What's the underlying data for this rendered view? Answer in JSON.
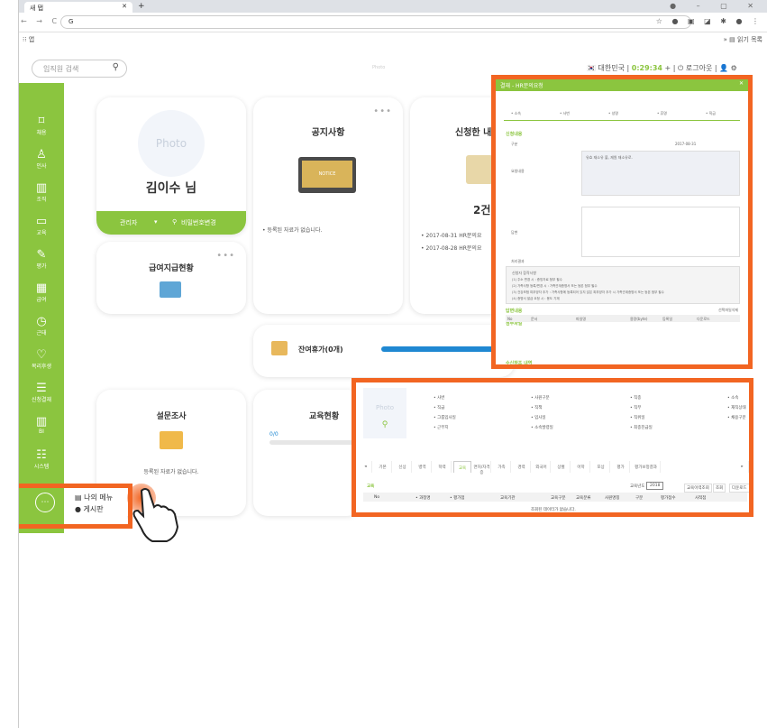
{
  "browser": {
    "tab_title": "새 탭",
    "address": "G",
    "bookmarks_left": "앱",
    "bookmarks_right": "읽기 목록"
  },
  "header": {
    "search_placeholder": "임직원 검색",
    "photo_label": "Photo",
    "country": "대한민국",
    "timer": "0:29:34",
    "plus": "+",
    "logout": "로그아웃"
  },
  "sidebar": {
    "items": [
      {
        "label": "채용",
        "icon": "bookmark-icon"
      },
      {
        "label": "인사",
        "icon": "person-icon"
      },
      {
        "label": "조직",
        "icon": "building-icon"
      },
      {
        "label": "교육",
        "icon": "laptop-icon"
      },
      {
        "label": "평가",
        "icon": "edit-icon"
      },
      {
        "label": "급여",
        "icon": "calculator-icon"
      },
      {
        "label": "근태",
        "icon": "clock-icon"
      },
      {
        "label": "복리후생",
        "icon": "heart-icon"
      },
      {
        "label": "신청결재",
        "icon": "list-icon"
      },
      {
        "label": "BI",
        "icon": "chart-icon"
      },
      {
        "label": "시스템",
        "icon": "settings-icon"
      }
    ],
    "more": "⋯"
  },
  "profile": {
    "photo": "Photo",
    "name": "김이수 님",
    "role": "관리자",
    "pw_change": "비밀번호변경"
  },
  "notice": {
    "title": "공지사항",
    "icon_text": "NOTICE",
    "empty": "등록된 자료가 없습니다."
  },
  "applied": {
    "title": "신청한 내",
    "count": "2건",
    "items": [
      "2017-08-31 HR문의요",
      "2017-08-28 HR문의요"
    ]
  },
  "payroll": {
    "title": "급여지급현황"
  },
  "vacation": {
    "title": "잔여휴가(0개)"
  },
  "survey": {
    "title": "설문조사",
    "empty": "등록된 자료가 없습니다."
  },
  "education": {
    "title": "교육현황",
    "progress_text": "0/0"
  },
  "menu_popup": {
    "my_menu": "나의 메뉴",
    "board": "게시판"
  },
  "popup": {
    "title": "결재 - HR문의요청",
    "fields": [
      "• 소속",
      "• 사번",
      "• 성명",
      "• 휴명",
      "• 직급"
    ],
    "sections": [
      "신청내용",
      "답변내용",
      "첨부파일",
      "수신참조 내역"
    ],
    "rows": [
      "구분",
      "요청내용",
      "답변",
      "처리결과"
    ],
    "date_val": "2017-08-31",
    "textarea_text": "유효 재소유 불, 재원 재소유로.",
    "notice_title": "신청자 참작사항",
    "notice_lines": [
      "(1) 주소 변경 시 : 증빙자료 첨부 필수",
      "(2) 가족사항 등록/변경 시 : 가족관계증명서 또는 등본 첨부 필수",
      "(3) 건강보험 피부양자 추가 : 가족사항에 등록되어 있지 않은 피부양자 추가 시 가족관계증명서 또는 등본 첨부 필수",
      "(4) 증명서 발급 요청 시 : 용도 기재"
    ],
    "file_headers": [
      "No",
      "문서",
      "파일명",
      "용량(byte)",
      "등록일",
      "다운로드"
    ],
    "file_btn": "선택파일삭제"
  },
  "bottom": {
    "photo": "Photo",
    "fields": [
      "• 사번",
      "• 직급",
      "• 그룹입사일",
      "• 근무지",
      "• 사원구분",
      "• 직책",
      "• 입사일",
      "• 소속발령일",
      "• 직종",
      "• 직무",
      "• 직위일",
      "• 최종진급일",
      "• 소속",
      "• 재직상태",
      "• 채용구분"
    ],
    "tabs": [
      "기본",
      "신상",
      "병역",
      "학력",
      "교육",
      "면허/자격증",
      "가족",
      "경력",
      "외국어",
      "상벌",
      "어학",
      "포상",
      "평가",
      "평가보정결과"
    ],
    "section": "교육",
    "year_label": "교육년도",
    "year_value": "2018",
    "btns": [
      "교육이력조회",
      "조회",
      "다운로드"
    ],
    "headers": [
      "No",
      "• 과정명",
      "• 평가점",
      "교육기관",
      "교육구분",
      "교육분류",
      "사원명칭",
      "구분",
      "평가점수",
      "사적점"
    ],
    "empty": "조회된 데이터가 없습니다."
  },
  "colors": {
    "green": "#8bc53f",
    "orange": "#f26522",
    "blue": "#1f88d2"
  }
}
